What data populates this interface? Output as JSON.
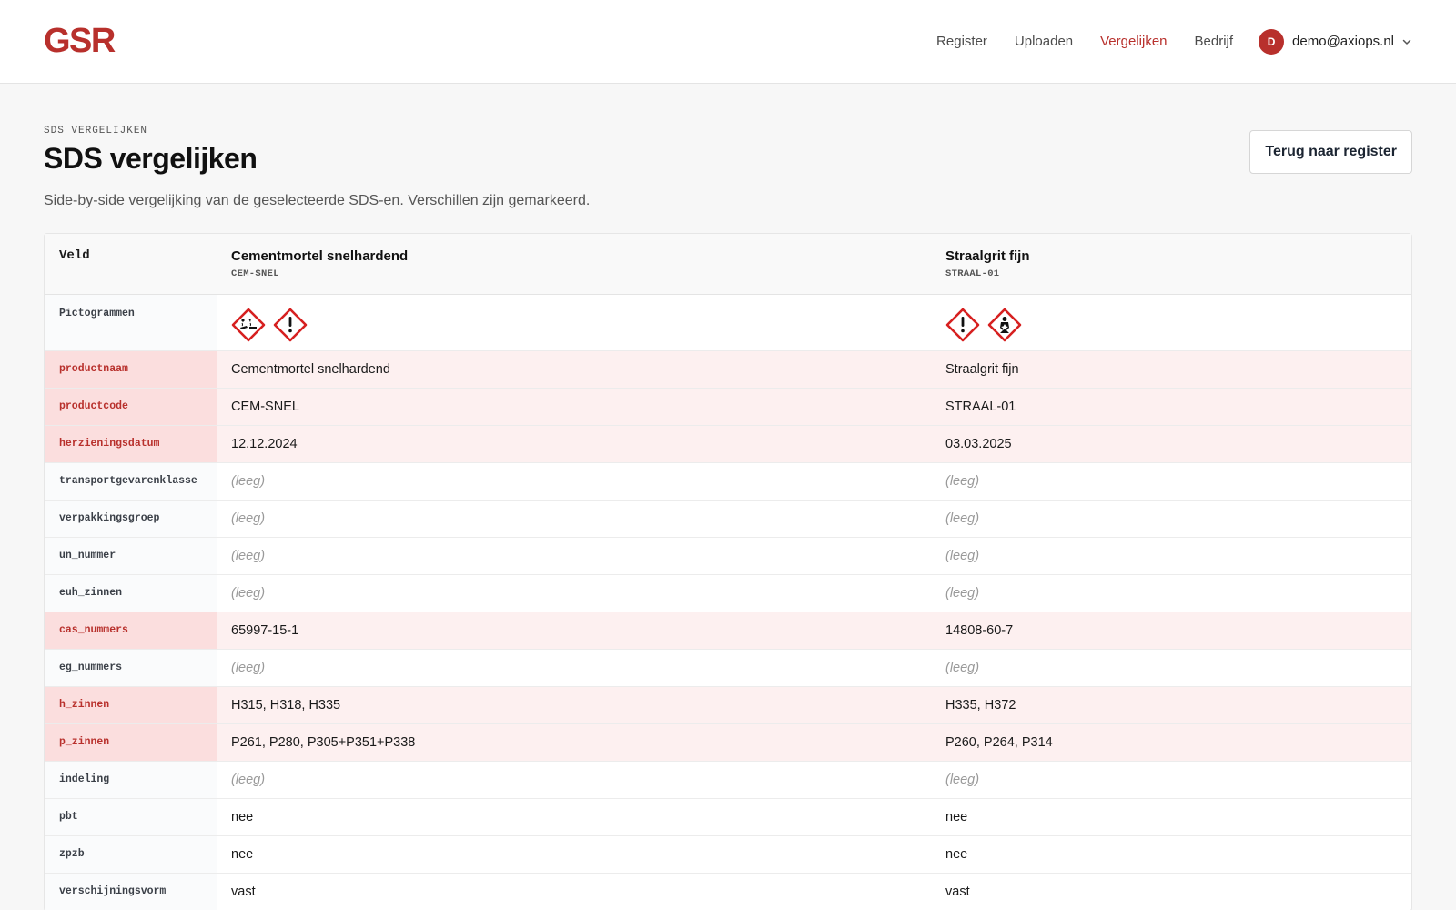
{
  "app": {
    "logo": "GSR"
  },
  "nav": {
    "items": [
      {
        "label": "Register",
        "active": false
      },
      {
        "label": "Uploaden",
        "active": false
      },
      {
        "label": "Vergelijken",
        "active": true
      },
      {
        "label": "Bedrijf",
        "active": false
      }
    ],
    "user": {
      "initial": "D",
      "email": "demo@axiops.nl"
    }
  },
  "page": {
    "eyebrow": "SDS VERGELIJKEN",
    "title": "SDS vergelijken",
    "subtitle": "Side-by-side vergelijking van de geselecteerde SDS-en. Verschillen zijn gemarkeerd.",
    "back_button": "Terug naar register"
  },
  "colors": {
    "accent": "#b8302c",
    "diff_field_bg": "#fbdede",
    "diff_row_bg": "#fdf0f0",
    "empty_text": "#9a9a9a"
  },
  "compare": {
    "field_header": "Veld",
    "products": [
      {
        "name": "Cementmortel snelhardend",
        "code": "CEM-SNEL"
      },
      {
        "name": "Straalgrit fijn",
        "code": "STRAAL-01"
      }
    ],
    "pictograms_label": "Pictogrammen",
    "pictograms": [
      [
        "ghs05-corrosive-icon",
        "ghs07-exclamation-icon"
      ],
      [
        "ghs07-exclamation-icon",
        "ghs08-health-hazard-icon"
      ]
    ],
    "empty_label": "(leeg)",
    "rows": [
      {
        "field": "productnaam",
        "diff": true,
        "values": [
          "Cementmortel snelhardend",
          "Straalgrit fijn"
        ]
      },
      {
        "field": "productcode",
        "diff": true,
        "values": [
          "CEM-SNEL",
          "STRAAL-01"
        ]
      },
      {
        "field": "herzieningsdatum",
        "diff": true,
        "values": [
          "12.12.2024",
          "03.03.2025"
        ]
      },
      {
        "field": "transportgevarenklasse",
        "diff": false,
        "values": [
          null,
          null
        ]
      },
      {
        "field": "verpakkingsgroep",
        "diff": false,
        "values": [
          null,
          null
        ]
      },
      {
        "field": "un_nummer",
        "diff": false,
        "values": [
          null,
          null
        ]
      },
      {
        "field": "euh_zinnen",
        "diff": false,
        "values": [
          null,
          null
        ]
      },
      {
        "field": "cas_nummers",
        "diff": true,
        "values": [
          "65997-15-1",
          "14808-60-7"
        ]
      },
      {
        "field": "eg_nummers",
        "diff": false,
        "values": [
          null,
          null
        ]
      },
      {
        "field": "h_zinnen",
        "diff": true,
        "values": [
          "H315, H318, H335",
          "H335, H372"
        ]
      },
      {
        "field": "p_zinnen",
        "diff": true,
        "values": [
          "P261, P280, P305+P351+P338",
          "P260, P264, P314"
        ]
      },
      {
        "field": "indeling",
        "diff": false,
        "values": [
          null,
          null
        ]
      },
      {
        "field": "pbt",
        "diff": false,
        "values": [
          "nee",
          "nee"
        ]
      },
      {
        "field": "zpzb",
        "diff": false,
        "values": [
          "nee",
          "nee"
        ]
      },
      {
        "field": "verschijningsvorm",
        "diff": false,
        "values": [
          "vast",
          "vast"
        ]
      }
    ]
  }
}
